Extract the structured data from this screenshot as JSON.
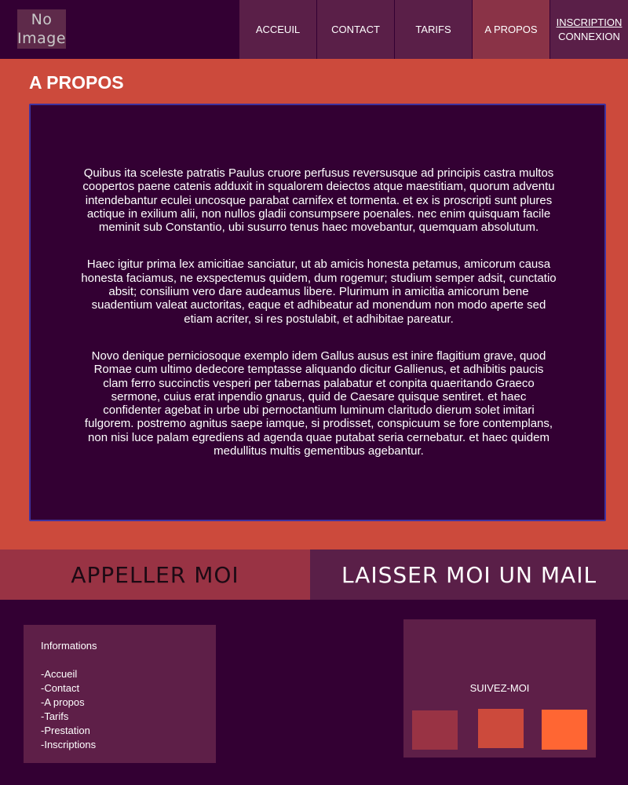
{
  "header": {
    "logo_line1": "No",
    "logo_line2": "Image",
    "nav": [
      {
        "label": "ACCEUIL"
      },
      {
        "label": "CONTACT"
      },
      {
        "label": "TARIFS"
      },
      {
        "label": "A PROPOS"
      }
    ],
    "auth": {
      "signup": "INSCRIPTION",
      "login": "CONNEXION"
    }
  },
  "main": {
    "title": "A PROPOS",
    "paragraphs": [
      "Quibus ita sceleste patratis Paulus cruore perfusus reversusque ad principis castra multos coopertos paene catenis adduxit in squalorem deiectos atque maestitiam, quorum adventu intendebantur eculei uncosque parabat carnifex et tormenta. et ex is proscripti sunt plures actique in exilium alii, non nullos gladii consumpsere poenales. nec enim quisquam facile meminit sub Constantio, ubi susurro tenus haec movebantur, quemquam absolutum.",
      "Haec igitur prima lex amicitiae sanciatur, ut ab amicis honesta petamus, amicorum causa honesta faciamus, ne exspectemus quidem, dum rogemur; studium semper adsit, cunctatio absit; consilium vero dare audeamus libere. Plurimum in amicitia amicorum bene suadentium valeat auctoritas, eaque et adhibeatur ad monendum non modo aperte sed etiam acriter, si res postulabit, et adhibitae pareatur.",
      "Novo denique perniciosoque exemplo idem Gallus ausus est inire flagitium grave, quod Romae cum ultimo dedecore temptasse aliquando dicitur Gallienus, et adhibitis paucis clam ferro succinctis vesperi per tabernas palabatur et conpita quaeritando Graeco sermone, cuius erat inpendio gnarus, quid de Caesare quisque sentiret. et haec confidenter agebat in urbe ubi pernoctantium luminum claritudo dierum solet imitari fulgorem. postremo agnitus saepe iamque, si prodisset, conspicuum se fore contemplans, non nisi luce palam egrediens ad agenda quae putabat seria cernebatur. et haec quidem medullitus multis gementibus agebantur."
    ]
  },
  "cta": {
    "call": "APPELLER MOI",
    "mail": "LAISSER MOI UN MAIL"
  },
  "footer": {
    "info_title": "Informations",
    "links": [
      "-Accueil",
      "-Contact",
      "-A propos",
      "-Tarifs",
      "-Prestation",
      "-Inscriptions"
    ],
    "social_title": "SUIVEZ-MOI"
  },
  "colors": {
    "background": "#330033",
    "accent_red": "#cc4a3c",
    "plum": "#5a1f48",
    "rose": "#993344",
    "orange": "#ff6633"
  }
}
